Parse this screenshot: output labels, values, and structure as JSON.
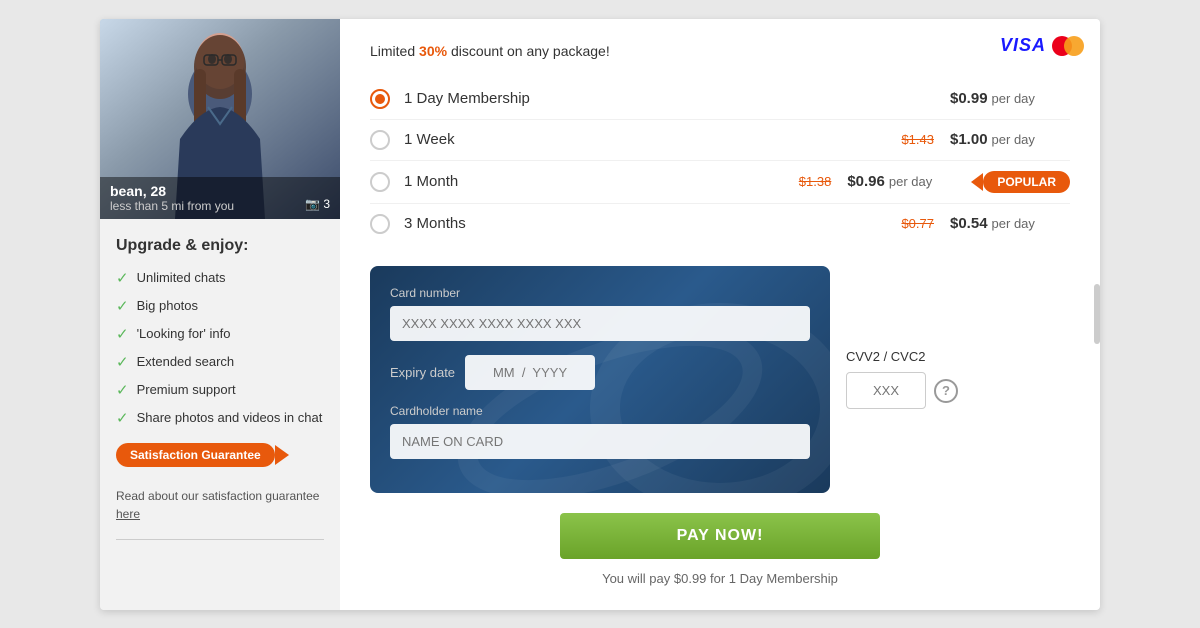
{
  "page": {
    "background": "#e8e8e8"
  },
  "profile": {
    "name": "bean",
    "age": "28",
    "distance": "less than 5 mi from you",
    "photo_count": "3"
  },
  "left_panel": {
    "upgrade_title": "Upgrade & enjoy:",
    "features": [
      {
        "label": "Unlimited chats"
      },
      {
        "label": "Big photos"
      },
      {
        "label": "'Looking for' info"
      },
      {
        "label": "Extended search"
      },
      {
        "label": "Premium support"
      },
      {
        "label": "Share photos and videos in chat"
      }
    ],
    "satisfaction_badge": "Satisfaction Guarantee",
    "guarantee_text": "Read about our satisfaction guarantee",
    "guarantee_link": "here"
  },
  "right_panel": {
    "discount_text_1": "Limited ",
    "discount_pct": "30%",
    "discount_text_2": " discount on any package!",
    "payment_logos": {
      "visa": "VISA",
      "mastercard": "MC"
    },
    "membership_options": [
      {
        "id": "1day",
        "label": "1 Day Membership",
        "original_price": null,
        "price": "$0.99",
        "per_day": "per day",
        "selected": true,
        "popular": false
      },
      {
        "id": "1week",
        "label": "1 Week",
        "original_price": "$1.43",
        "price": "$1.00",
        "per_day": "per day",
        "selected": false,
        "popular": false
      },
      {
        "id": "1month",
        "label": "1 Month",
        "original_price": "$1.38",
        "price": "$0.96",
        "per_day": "per day",
        "selected": false,
        "popular": true
      },
      {
        "id": "3months",
        "label": "3 Months",
        "original_price": "$0.77",
        "price": "$0.54",
        "per_day": "per day",
        "selected": false,
        "popular": false
      }
    ],
    "popular_label": "POPULAR",
    "card_form": {
      "card_number_label": "Card number",
      "card_number_placeholder": "XXXX XXXX XXXX XXXX XXX",
      "expiry_label": "Expiry date",
      "expiry_placeholder": "MM  /  YYYY",
      "cardholder_label": "Cardholder name",
      "cardholder_placeholder": "NAME ON CARD",
      "cvv_label": "CVV2 / CVC2",
      "cvv_placeholder": "XXX"
    },
    "pay_button_label": "PAY NOW!",
    "payment_summary": "You will pay $0.99 for 1 Day Membership"
  }
}
